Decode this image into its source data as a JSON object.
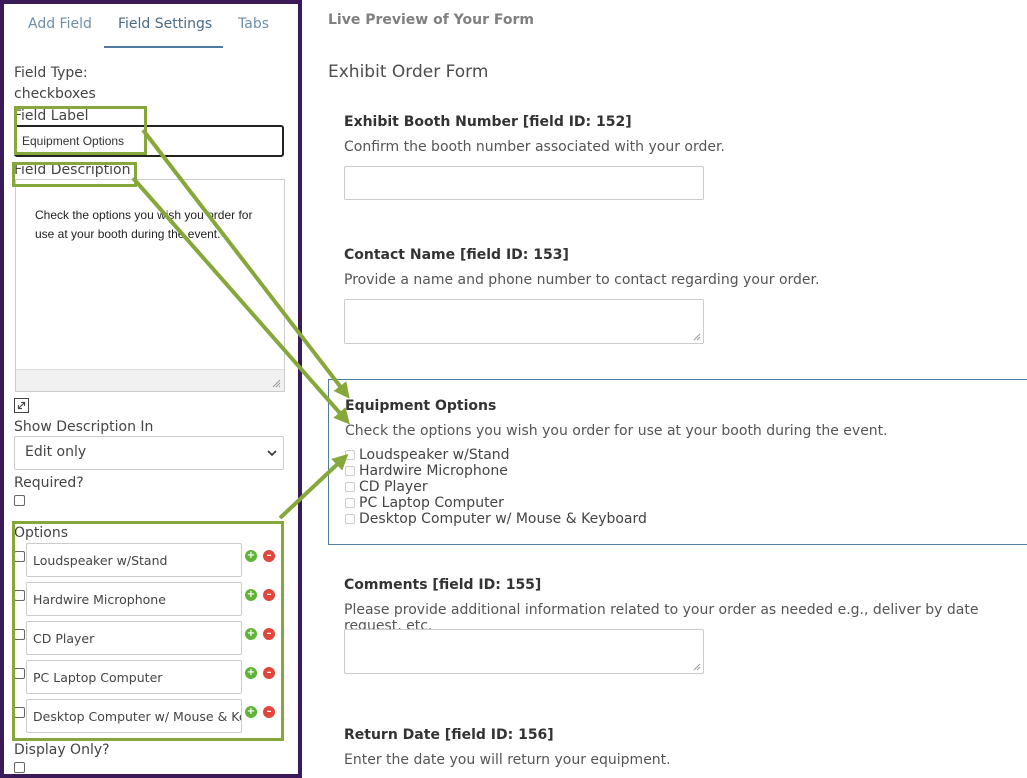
{
  "tabs": {
    "add_field": "Add Field",
    "field_settings": "Field Settings",
    "tabs": "Tabs"
  },
  "settings": {
    "field_type_label": "Field Type:",
    "field_type_value": "checkboxes",
    "field_label_label": "Field Label",
    "field_label_value": "Equipment Options",
    "field_description_label": "Field Description",
    "field_description_value": "Check the options you  wish you order for use at your booth during the event.",
    "show_description_label": "Show Description In",
    "show_description_value": "Edit only",
    "required_label": "Required?",
    "options_label": "Options",
    "options": [
      {
        "label": "Loudspeaker w/Stand"
      },
      {
        "label": "Hardwire Microphone"
      },
      {
        "label": "CD Player"
      },
      {
        "label": "PC Laptop Computer"
      },
      {
        "label": "Desktop Computer w/ Mouse & Keyboard"
      }
    ],
    "display_only_label": "Display Only?"
  },
  "preview": {
    "heading": "Live Preview of Your Form",
    "form_title": "Exhibit Order Form",
    "questions": [
      {
        "title": "Exhibit Booth Number [field ID: 152]",
        "help": "Confirm the booth number associated with your order."
      },
      {
        "title": "Contact Name [field ID: 153]",
        "help": "Provide a name and phone number to contact regarding your order."
      },
      {
        "title": "Equipment Options",
        "help": "Check the options you  wish you order for use at your booth during the event."
      },
      {
        "title": "Comments [field ID: 155]",
        "help": "Please provide additional information related to your order as needed e.g., deliver by date request, etc."
      },
      {
        "title": "Return Date [field ID: 156]",
        "help": "Enter the date you will return your equipment."
      }
    ],
    "equipment_options": [
      "Loudspeaker w/Stand",
      "Hardwire Microphone",
      "CD Player",
      "PC Laptop Computer",
      "Desktop Computer w/ Mouse & Keyboard"
    ]
  },
  "colors": {
    "panel_border": "#3b1a5a",
    "highlight": "#86a73a",
    "tab_active_underline": "#4f79a3",
    "add_icon": "#5fb336",
    "remove_icon": "#e0463c"
  },
  "icons": {
    "expand": "expand-icon",
    "chevron": "chevron-down-icon",
    "add": "plus-circle-icon",
    "remove": "minus-circle-icon"
  }
}
